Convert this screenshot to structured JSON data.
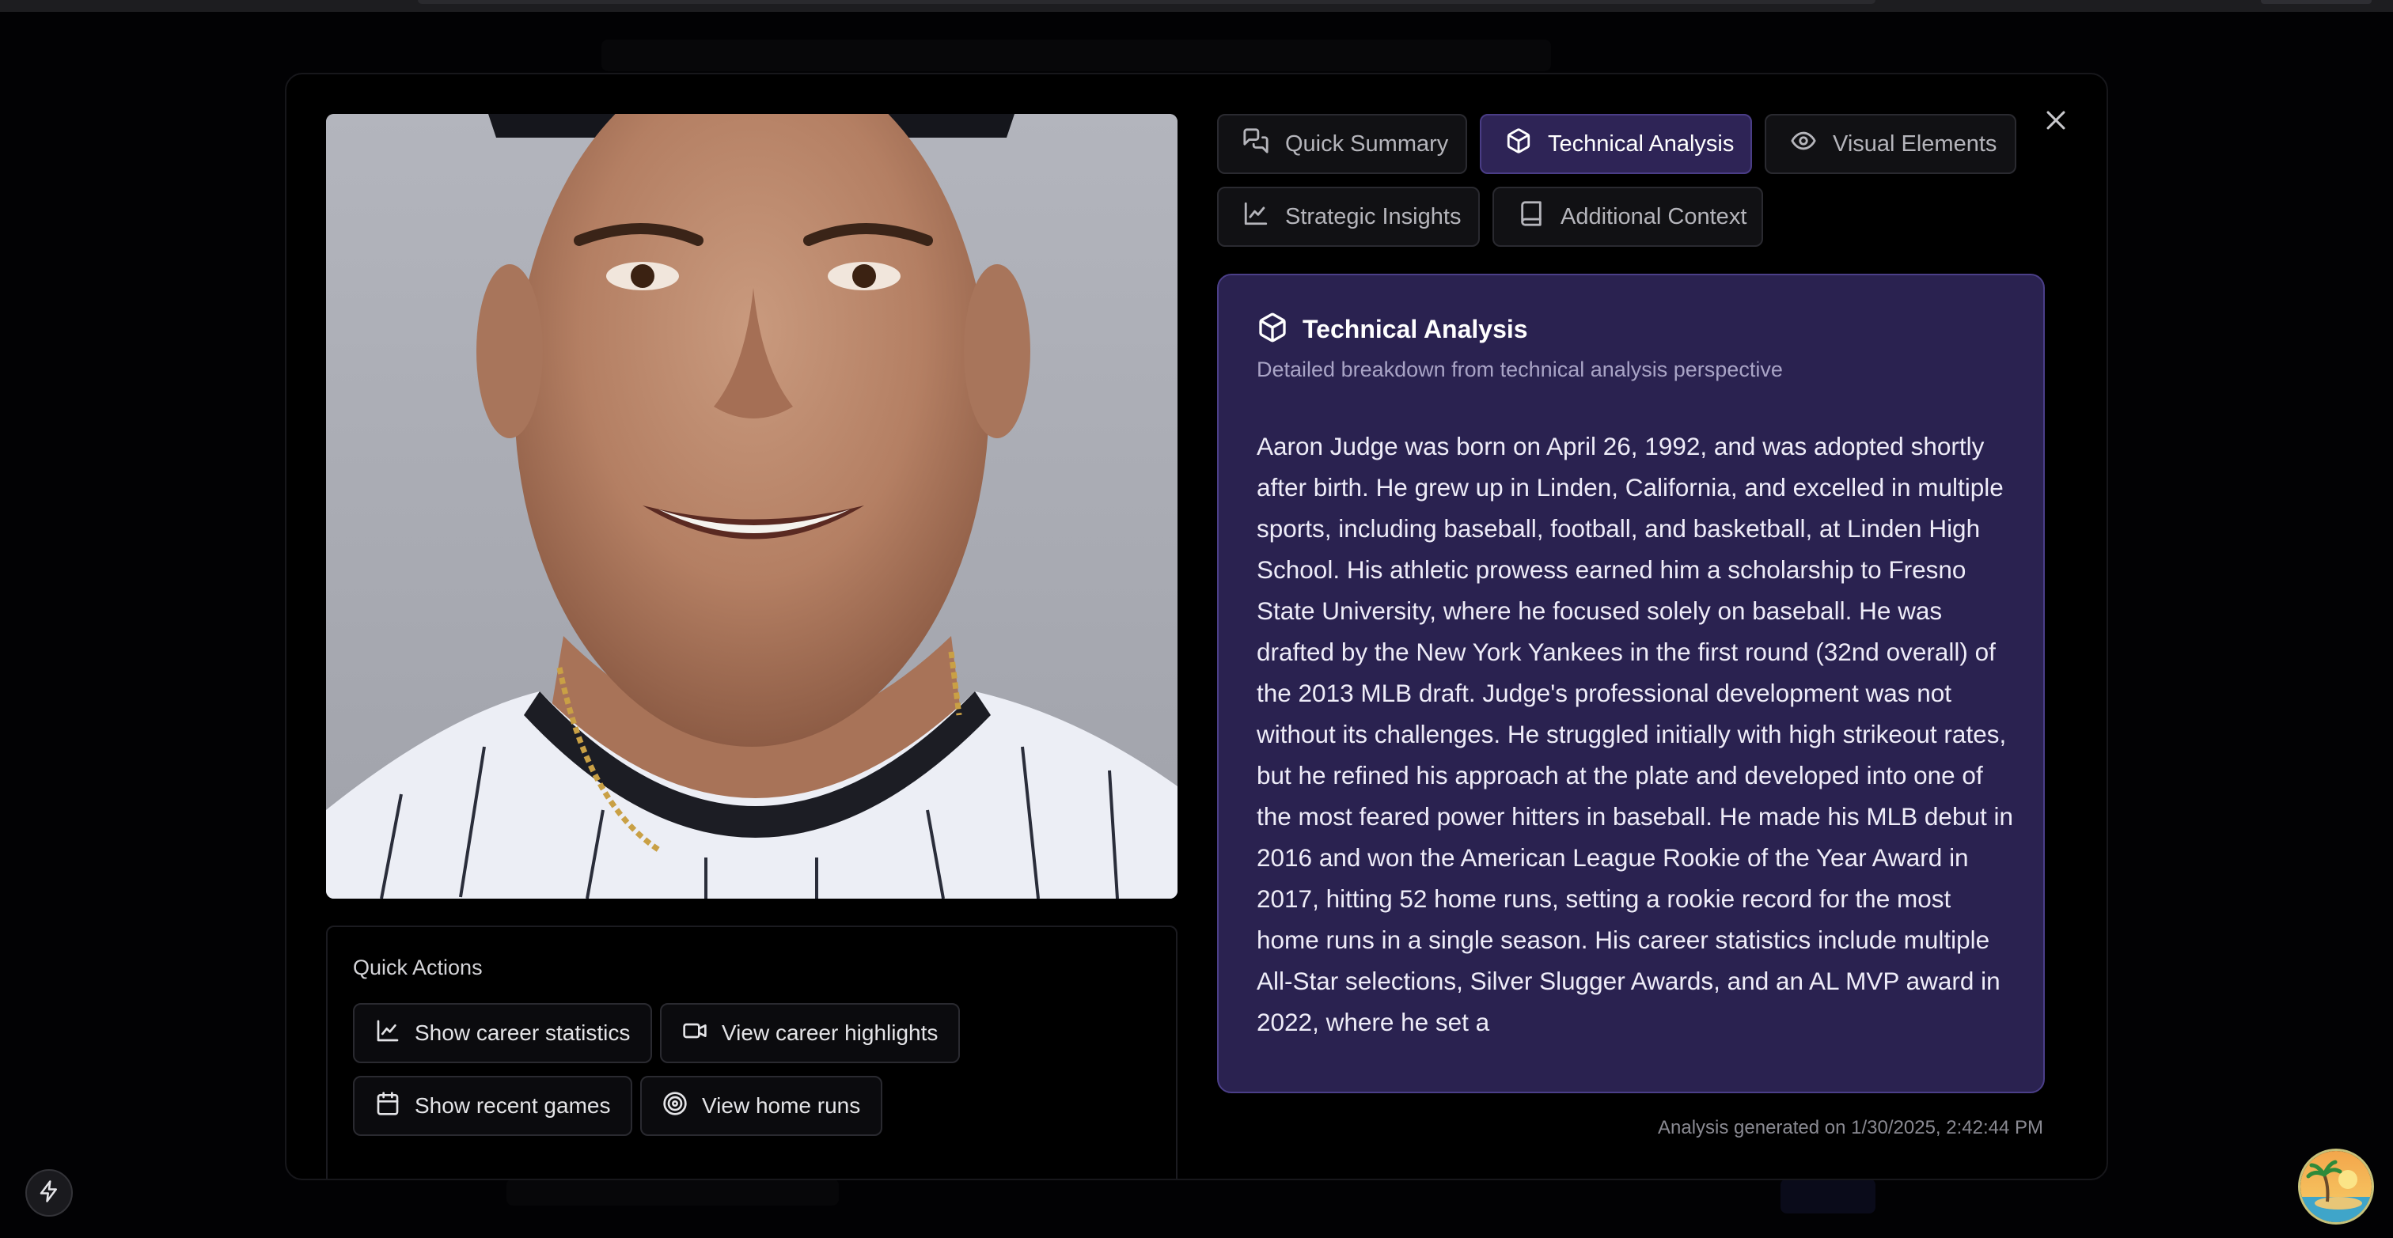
{
  "tabs": [
    {
      "label": "Quick Summary",
      "icon": "chat-bubbles-icon",
      "active": false
    },
    {
      "label": "Technical Analysis",
      "icon": "cube-icon",
      "active": true
    },
    {
      "label": "Visual Elements",
      "icon": "eye-icon",
      "active": false
    },
    {
      "label": "Strategic Insights",
      "icon": "line-chart-icon",
      "active": false
    },
    {
      "label": "Additional Context",
      "icon": "book-icon",
      "active": false
    }
  ],
  "close_icon": "close-icon",
  "card": {
    "title": "Technical Analysis",
    "subtitle": "Detailed breakdown from technical analysis perspective",
    "body": "Aaron Judge was born on April 26, 1992, and was adopted shortly after birth. He grew up in Linden, California, and excelled in multiple sports, including baseball, football, and basketball, at Linden High School. His athletic prowess earned him a scholarship to Fresno State University, where he focused solely on baseball. He was drafted by the New York Yankees in the first round (32nd overall) of the 2013 MLB draft. Judge's professional development was not without its challenges. He struggled initially with high strikeout rates, but he refined his approach at the plate and developed into one of the most feared power hitters in baseball. He made his MLB debut in 2016 and won the American League Rookie of the Year Award in 2017, hitting 52 home runs, setting a rookie record for the most home runs in a single season. His career statistics include multiple All-Star selections, Silver Slugger Awards, and an AL MVP award in 2022, where he set a"
  },
  "quick_actions": {
    "title": "Quick Actions",
    "buttons": [
      {
        "label": "Show career statistics",
        "icon": "line-chart-icon"
      },
      {
        "label": "View career highlights",
        "icon": "video-icon"
      },
      {
        "label": "Show recent games",
        "icon": "calendar-icon"
      },
      {
        "label": "View home runs",
        "icon": "target-icon"
      }
    ]
  },
  "footer_note": "Analysis generated on 1/30/2025, 2:42:44 PM",
  "colors": {
    "accent": "#2e2456",
    "accent_border": "#4b3f88",
    "background": "#000000"
  }
}
